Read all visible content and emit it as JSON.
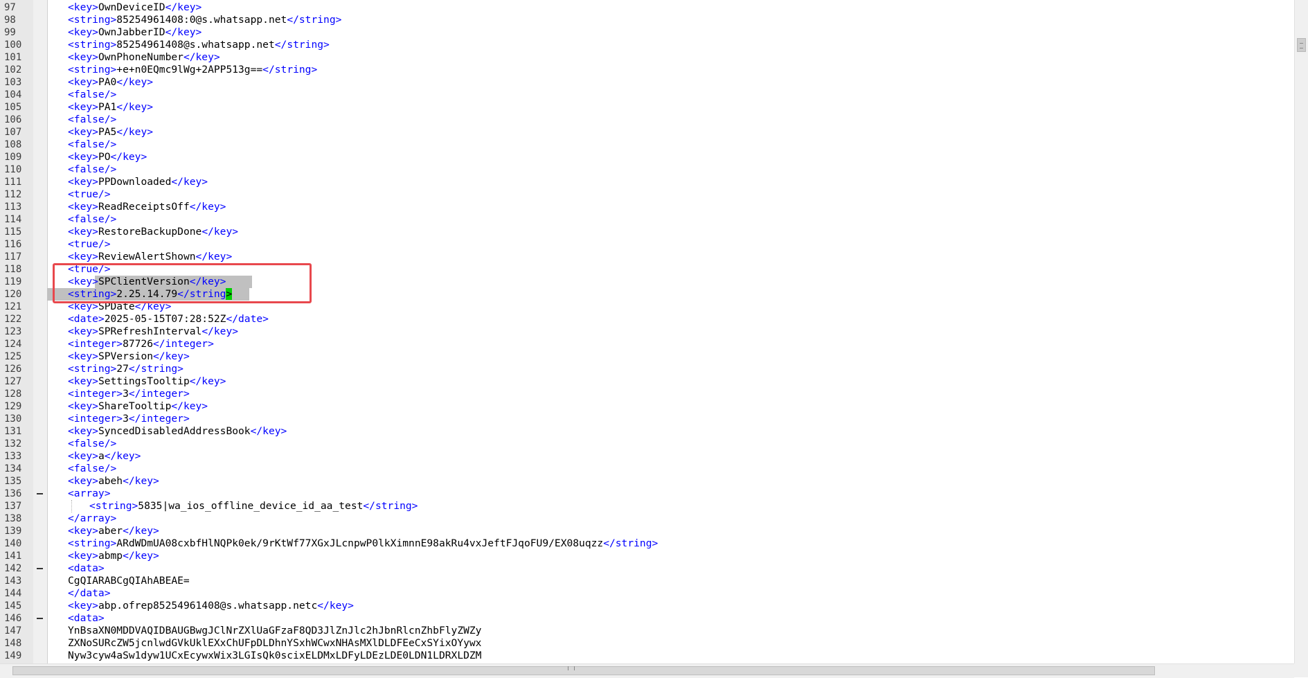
{
  "editor": {
    "lines": [
      {
        "n": "97",
        "p": [
          "<key>",
          "OwnDeviceID",
          "</key>"
        ]
      },
      {
        "n": "98",
        "p": [
          "<string>",
          "85254961408:0@s.whatsapp.net",
          "</string>"
        ]
      },
      {
        "n": "99",
        "p": [
          "<key>",
          "OwnJabberID",
          "</key>"
        ]
      },
      {
        "n": "100",
        "p": [
          "<string>",
          "85254961408@s.whatsapp.net",
          "</string>"
        ]
      },
      {
        "n": "101",
        "p": [
          "<key>",
          "OwnPhoneNumber",
          "</key>"
        ]
      },
      {
        "n": "102",
        "p": [
          "<string>",
          "+e+n0EQmc9lWg+2APP513g==",
          "</string>"
        ]
      },
      {
        "n": "103",
        "p": [
          "<key>",
          "PA0",
          "</key>"
        ]
      },
      {
        "n": "104",
        "p": [
          "<false/>"
        ]
      },
      {
        "n": "105",
        "p": [
          "<key>",
          "PA1",
          "</key>"
        ]
      },
      {
        "n": "106",
        "p": [
          "<false/>"
        ]
      },
      {
        "n": "107",
        "p": [
          "<key>",
          "PA5",
          "</key>"
        ]
      },
      {
        "n": "108",
        "p": [
          "<false/>"
        ]
      },
      {
        "n": "109",
        "p": [
          "<key>",
          "PO",
          "</key>"
        ]
      },
      {
        "n": "110",
        "p": [
          "<false/>"
        ]
      },
      {
        "n": "111",
        "p": [
          "<key>",
          "PPDownloaded",
          "</key>"
        ]
      },
      {
        "n": "112",
        "p": [
          "<true/>"
        ]
      },
      {
        "n": "113",
        "p": [
          "<key>",
          "ReadReceiptsOff",
          "</key>"
        ]
      },
      {
        "n": "114",
        "p": [
          "<false/>"
        ]
      },
      {
        "n": "115",
        "p": [
          "<key>",
          "RestoreBackupDone",
          "</key>"
        ]
      },
      {
        "n": "116",
        "p": [
          "<true/>"
        ]
      },
      {
        "n": "117",
        "p": [
          "<key>",
          "ReviewAlertShown",
          "</key>"
        ]
      },
      {
        "n": "118",
        "p": [
          "<true/>"
        ]
      },
      {
        "n": "119",
        "p": [
          "<key>",
          "SPClientVersion",
          "</key>"
        ],
        "selected": "partial"
      },
      {
        "n": "120",
        "p": [
          "<string>",
          "2.25.14.79",
          "</string",
          ">"
        ],
        "selected": "full"
      },
      {
        "n": "121",
        "p": [
          "<key>",
          "SPDate",
          "</key>"
        ]
      },
      {
        "n": "122",
        "p": [
          "<date>",
          "2025-05-15T07:28:52Z",
          "</date>"
        ]
      },
      {
        "n": "123",
        "p": [
          "<key>",
          "SPRefreshInterval",
          "</key>"
        ]
      },
      {
        "n": "124",
        "p": [
          "<integer>",
          "87726",
          "</integer>"
        ]
      },
      {
        "n": "125",
        "p": [
          "<key>",
          "SPVersion",
          "</key>"
        ]
      },
      {
        "n": "126",
        "p": [
          "<string>",
          "27",
          "</string>"
        ]
      },
      {
        "n": "127",
        "p": [
          "<key>",
          "SettingsTooltip",
          "</key>"
        ]
      },
      {
        "n": "128",
        "p": [
          "<integer>",
          "3",
          "</integer>"
        ]
      },
      {
        "n": "129",
        "p": [
          "<key>",
          "ShareTooltip",
          "</key>"
        ]
      },
      {
        "n": "130",
        "p": [
          "<integer>",
          "3",
          "</integer>"
        ]
      },
      {
        "n": "131",
        "p": [
          "<key>",
          "SyncedDisabledAddressBook",
          "</key>"
        ]
      },
      {
        "n": "132",
        "p": [
          "<false/>"
        ]
      },
      {
        "n": "133",
        "p": [
          "<key>",
          "a",
          "</key>"
        ]
      },
      {
        "n": "134",
        "p": [
          "<false/>"
        ]
      },
      {
        "n": "135",
        "p": [
          "<key>",
          "abeh",
          "</key>"
        ]
      },
      {
        "n": "136",
        "p": [
          "<array>"
        ],
        "fold": true
      },
      {
        "n": "137",
        "p": [
          "<string>",
          "5835|wa_ios_offline_device_id_aa_test",
          "</string>"
        ],
        "indent": true
      },
      {
        "n": "138",
        "p": [
          "</array>"
        ]
      },
      {
        "n": "139",
        "p": [
          "<key>",
          "aber",
          "</key>"
        ]
      },
      {
        "n": "140",
        "p": [
          "<string>",
          "ARdWDmUA08cxbfHlNQPk0ek/9rKtWf77XGxJLcnpwP0lkXimnnE98akRu4vxJeftFJqoFU9/EX08uqzz",
          "</string>"
        ]
      },
      {
        "n": "141",
        "p": [
          "<key>",
          "abmp",
          "</key>"
        ]
      },
      {
        "n": "142",
        "p": [
          "<data>"
        ],
        "fold": true
      },
      {
        "n": "143",
        "p": [
          "",
          "CgQIARABCgQIAhABEAE="
        ]
      },
      {
        "n": "144",
        "p": [
          "</data>"
        ]
      },
      {
        "n": "145",
        "p": [
          "<key>",
          "abp.ofrep85254961408@s.whatsapp.netc",
          "</key>"
        ]
      },
      {
        "n": "146",
        "p": [
          "<data>"
        ],
        "fold": true
      },
      {
        "n": "147",
        "p": [
          "",
          "YnBsaXN0MDDVAQIDBAUGBwgJClNrZXlUaGFzaF8QD3JlZnJlc2hJbnRlcnZhbFlyZWZy"
        ]
      },
      {
        "n": "148",
        "p": [
          "",
          "ZXNoSURcZW5jcnlwdGVkUklEXxChUFpDLDhnYSxhWCwxNHAsMXlDLDFEeCxSYixOYywx"
        ]
      },
      {
        "n": "149",
        "p": [
          "",
          "Nyw3cyw4aSw1dyw1UCxEcywxWix3LGIsQk0scixELDMxLDFyLDEzLDE0LDN1LDRXLDZM"
        ]
      }
    ]
  }
}
